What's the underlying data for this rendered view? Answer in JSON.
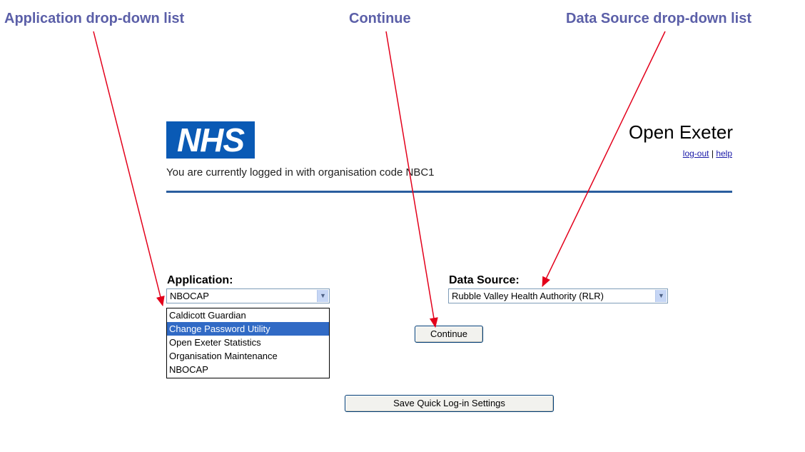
{
  "callouts": {
    "application": "Application drop-down list",
    "continue": "Continue",
    "data_source": "Data Source drop-down list"
  },
  "header": {
    "logo_text": "NHS",
    "title": "Open Exeter",
    "logout_label": "log-out",
    "separator": "|",
    "help_label": "help",
    "login_message": "You are currently logged in with organisation code NBC1"
  },
  "form": {
    "application_label": "Application:",
    "application_value": "NBOCAP",
    "application_options": [
      "Caldicott Guardian",
      "Change Password Utility",
      "Open Exeter Statistics",
      "Organisation Maintenance",
      "NBOCAP"
    ],
    "highlighted_option": "Change Password Utility",
    "data_source_label": "Data Source:",
    "data_source_value": "Rubble Valley Health Authority (RLR)",
    "continue_label": "Continue",
    "save_label": "Save Quick Log-in Settings"
  },
  "colors": {
    "callout_text": "#5b5fa8",
    "arrow": "#e3001b",
    "nhs_blue": "#0a5ab5",
    "rule": "#2a5d9e",
    "selection": "#316ac5"
  }
}
